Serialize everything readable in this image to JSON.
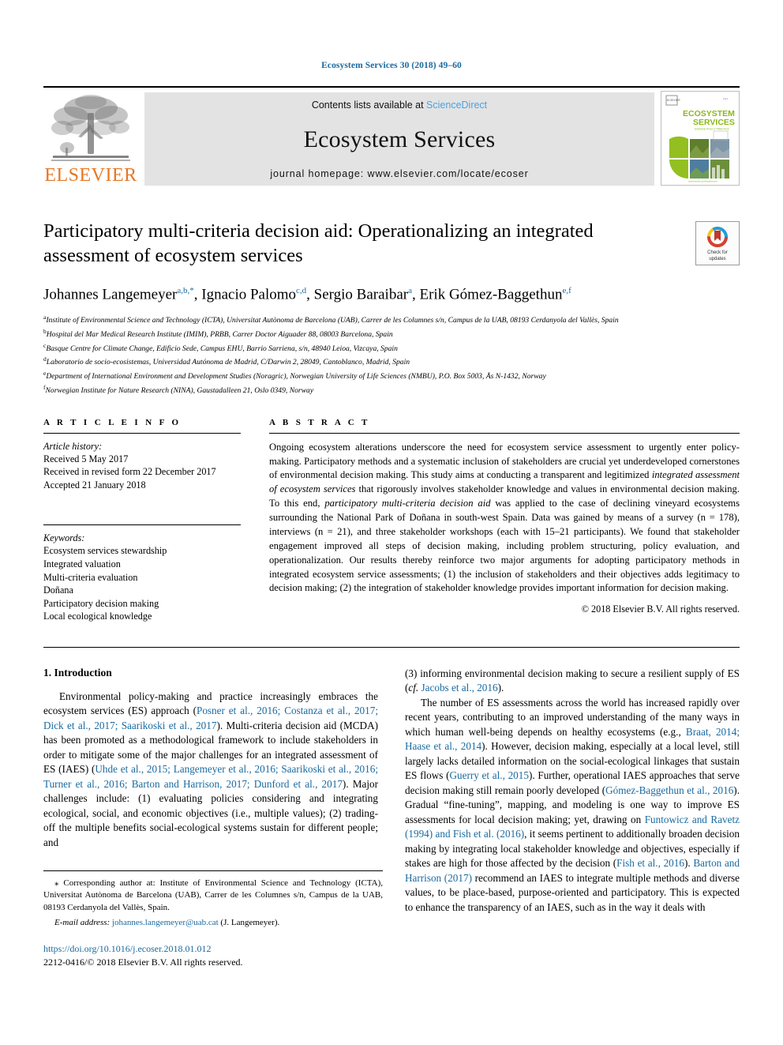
{
  "running_head": "Ecosystem Services 30 (2018) 49–60",
  "masthead": {
    "contents_prefix": "Contents lists available at ",
    "sciencedirect": "ScienceDirect",
    "journal_name": "Ecosystem Services",
    "homepage": "journal homepage: www.elsevier.com/locate/ecoser",
    "publisher_logo_text": "ELSEVIER",
    "cover": {
      "title_line1": "ECOSYSTEM",
      "title_line2": "SERVICES",
      "subtitle": "SCIENCE POLICY PRACTICE",
      "footer": "Ecosystem Services Coordinated 2015"
    },
    "colors": {
      "link": "#4aa3df",
      "elsevier_orange": "#E87722",
      "cover_green": "#93c020",
      "band": "#e3e3e3"
    }
  },
  "article": {
    "title": "Participatory multi-criteria decision aid: Operationalizing an integrated assessment of ecosystem services",
    "check_for_updates": {
      "line1": "Check for",
      "line2": "updates"
    },
    "authors": [
      {
        "name": "Johannes Langemeyer",
        "sup": "a,b,*"
      },
      {
        "name": "Ignacio Palomo",
        "sup": "c,d"
      },
      {
        "name": "Sergio Baraibar",
        "sup": "a"
      },
      {
        "name": "Erik Gómez-Baggethun",
        "sup": "e,f"
      }
    ],
    "affiliations": [
      {
        "mark": "a",
        "text": "Institute of Environmental Science and Technology (ICTA), Universitat Autònoma de Barcelona (UAB), Carrer de les Columnes s/n, Campus de la UAB, 08193 Cerdanyola del Vallès, Spain"
      },
      {
        "mark": "b",
        "text": "Hospital del Mar Medical Research Institute (IMIM), PRBB, Carrer Doctor Aiguader 88, 08003 Barcelona, Spain"
      },
      {
        "mark": "c",
        "text": "Basque Centre for Climate Change, Edificio Sede, Campus EHU, Barrio Sarriena, s/n, 48940 Leioa, Vizcaya, Spain"
      },
      {
        "mark": "d",
        "text": "Laboratorio de socio-ecosistemas, Universidad Autónoma de Madrid, C/Darwin 2, 28049, Cantoblanco, Madrid, Spain"
      },
      {
        "mark": "e",
        "text": "Department of International Environment and Development Studies (Noragric), Norwegian University of Life Sciences (NMBU), P.O. Box 5003, Ås N-1432, Norway"
      },
      {
        "mark": "f",
        "text": "Norwegian Institute for Nature Research (NINA), Gaustadalleen 21, Oslo 0349, Norway"
      }
    ]
  },
  "article_info": {
    "heading": "A R T I C L E   I N F O",
    "history_label": "Article history:",
    "history": [
      "Received 5 May 2017",
      "Received in revised form 22 December 2017",
      "Accepted 21 January 2018"
    ],
    "keywords_label": "Keywords:",
    "keywords": [
      "Ecosystem services stewardship",
      "Integrated valuation",
      "Multi-criteria evaluation",
      "Doñana",
      "Participatory decision making",
      "Local ecological knowledge"
    ]
  },
  "abstract": {
    "heading": "A B S T R A C T",
    "paragraph_parts": [
      {
        "t": "Ongoing ecosystem alterations underscore the need for ecosystem service assessment to urgently enter policy-making. Participatory methods and a systematic inclusion of stakeholders are crucial yet underdeveloped cornerstones of environmental decision making. This study aims at conducting a transparent and legitimized ",
        "i": false
      },
      {
        "t": "integrated assessment of ecosystem services",
        "i": true
      },
      {
        "t": " that rigorously involves stakeholder knowledge and values in environmental decision making. To this end, ",
        "i": false
      },
      {
        "t": "participatory multi-criteria decision aid",
        "i": true
      },
      {
        "t": " was applied to the case of declining vineyard ecosystems surrounding the National Park of Doñana in south-west Spain. Data was gained by means of a survey (n = 178), interviews (n = 21), and three stakeholder workshops (each with 15–21 participants). We found that stakeholder engagement improved all steps of decision making, including problem structuring, policy evaluation, and operationalization. Our results thereby reinforce two major arguments for adopting participatory methods in integrated ecosystem service assessments; (1) the inclusion of stakeholders and their objectives adds legitimacy to decision making; (2) the integration of stakeholder knowledge provides important information for decision making.",
        "i": false
      }
    ],
    "copyright": "© 2018 Elsevier B.V. All rights reserved."
  },
  "intro": {
    "heading": "1. Introduction",
    "left_paragraph_parts": [
      {
        "t": "Environmental policy-making and practice increasingly embraces the ecosystem services (ES) approach (",
        "r": false
      },
      {
        "t": "Posner et al., 2016; Costanza et al., 2017; Dick et al., 2017; Saarikoski et al., 2017",
        "r": true
      },
      {
        "t": "). Multi-criteria decision aid (MCDA) has been promoted as a methodological framework to include stakeholders in order to mitigate some of the major challenges for an integrated assessment of ES (IAES) (",
        "r": false
      },
      {
        "t": "Uhde et al., 2015; Langemeyer et al., 2016; Saarikoski et al., 2016; Turner et al., 2016; Barton and Harrison, 2017; Dunford et al., 2017",
        "r": true
      },
      {
        "t": "). Major challenges include: (1) evaluating policies considering and integrating ecological, social, and economic objectives (i.e., multiple values); (2) trading-off the multiple benefits social-ecological systems sustain for different people; and",
        "r": false
      }
    ],
    "right_paragraph1_parts": [
      {
        "t": "(3) informing environmental decision making to secure a resilient supply of ES (",
        "r": false
      },
      {
        "t": "cf. ",
        "r": false,
        "italic": true
      },
      {
        "t": "Jacobs et al., 2016",
        "r": true
      },
      {
        "t": ").",
        "r": false
      }
    ],
    "right_paragraph2_parts": [
      {
        "t": "The number of ES assessments across the world has increased rapidly over recent years, contributing to an improved understanding of the many ways in which human well-being depends on healthy ecosystems (e.g., ",
        "r": false
      },
      {
        "t": "Braat, 2014; Haase et al., 2014",
        "r": true
      },
      {
        "t": "). However, decision making, especially at a local level, still largely lacks detailed information on the social-ecological linkages that sustain ES flows (",
        "r": false
      },
      {
        "t": "Guerry et al., 2015",
        "r": true
      },
      {
        "t": "). Further, operational IAES approaches that serve decision making still remain poorly developed (",
        "r": false
      },
      {
        "t": "Gómez-Baggethun et al., 2016",
        "r": true
      },
      {
        "t": "). Gradual “fine-tuning”, mapping, and modeling is one way to improve ES assessments for local decision making; yet, drawing on ",
        "r": false
      },
      {
        "t": "Funtowicz and Ravetz (1994) and Fish et al. (2016)",
        "r": true
      },
      {
        "t": ", it seems pertinent to additionally broaden decision making by integrating local stakeholder knowledge and objectives, especially if stakes are high for those affected by the decision (",
        "r": false
      },
      {
        "t": "Fish et al., 2016",
        "r": true
      },
      {
        "t": "). ",
        "r": false
      },
      {
        "t": "Barton and Harrison (2017)",
        "r": true
      },
      {
        "t": " recommend an IAES to integrate multiple methods and diverse values, to be place-based, purpose-oriented and participatory. This is expected to enhance the transparency of an IAES, such as in the way it deals with",
        "r": false
      }
    ]
  },
  "footnote": {
    "corresponding_marker": "⁎",
    "corresponding_text": " Corresponding author at: Institute of Environmental Science and Technology (ICTA), Universitat Autònoma de Barcelona (UAB), Carrer de les Columnes s/n, Campus de la UAB, 08193 Cerdanyola del Vallès, Spain.",
    "email_label": "E-mail address:",
    "email": "johannes.langemeyer@uab.cat",
    "email_attrib": " (J. Langemeyer).",
    "doi": "https://doi.org/10.1016/j.ecoser.2018.01.012",
    "issn_line": "2212-0416/© 2018 Elsevier B.V. All rights reserved."
  }
}
